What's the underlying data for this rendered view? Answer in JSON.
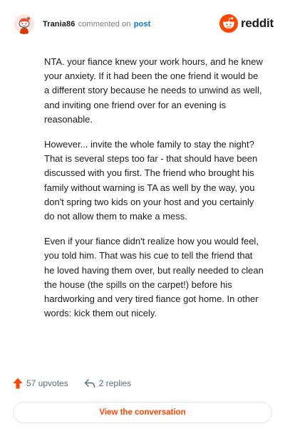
{
  "header": {
    "username": "Trania86",
    "action": "commented on",
    "target": "post",
    "brand": "reddit",
    "avatar_icon": "snoo-avatar-icon",
    "brand_icon": "reddit-logo-icon"
  },
  "comment": {
    "paragraphs": [
      "NTA. your fiance knew your work hours, and he knew your anxiety. If it had been the one friend it would be a different story because he needs to unwind as well, and inviting one friend over for an evening is reasonable.",
      "However... invite the whole family to stay the night? That is several steps too far - that should have been discussed with you first. The friend who brought his family without warning is TA as well by the way, you don't spring two kids on your host and you certainly do not allow them to make a mess.",
      "Even if your fiance didn't realize how you would feel, you told him. That was his cue to tell the friend that he loved having them over, but really needed to clean the house (the spills on the carpet!) before his hardworking and very tired fiance got home. In other words: kick them out nicely."
    ]
  },
  "footer": {
    "upvotes": "57 upvotes",
    "replies": "2 replies",
    "upvote_icon": "upvote-arrow-icon",
    "reply_icon": "reply-arrow-icon",
    "button_label": "View the conversation"
  },
  "colors": {
    "accent": "#ff4500",
    "link": "#0079d3",
    "muted": "#576f76"
  }
}
